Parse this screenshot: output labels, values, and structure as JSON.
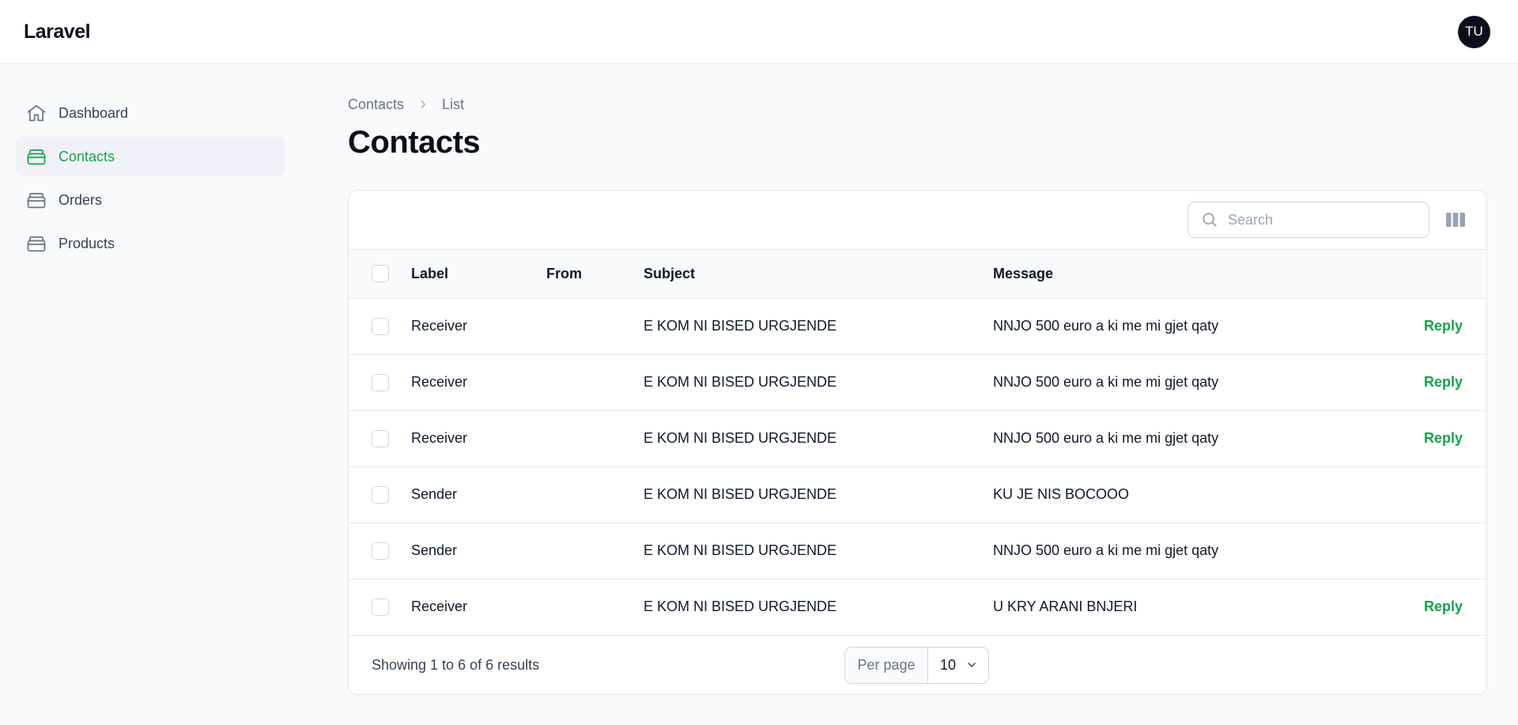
{
  "app": {
    "brand": "Laravel",
    "user_initials": "TU"
  },
  "sidebar": {
    "items": [
      {
        "label": "Dashboard",
        "icon": "home-icon",
        "active": false
      },
      {
        "label": "Contacts",
        "icon": "inbox-icon",
        "active": true
      },
      {
        "label": "Orders",
        "icon": "inbox-icon",
        "active": false
      },
      {
        "label": "Products",
        "icon": "inbox-icon",
        "active": false
      }
    ]
  },
  "breadcrumb": {
    "parent": "Contacts",
    "current": "List"
  },
  "page": {
    "title": "Contacts"
  },
  "search": {
    "placeholder": "Search",
    "value": ""
  },
  "table": {
    "columns": [
      "Label",
      "From",
      "Subject",
      "Message"
    ],
    "rows": [
      {
        "label": "Receiver",
        "from": "",
        "subject": "E KOM NI BISED URGJENDE",
        "message": "NNJO 500 euro a ki me mi gjet qaty",
        "action": "Reply"
      },
      {
        "label": "Receiver",
        "from": "",
        "subject": "E KOM NI BISED URGJENDE",
        "message": "NNJO 500 euro a ki me mi gjet qaty",
        "action": "Reply"
      },
      {
        "label": "Receiver",
        "from": "",
        "subject": "E KOM NI BISED URGJENDE",
        "message": "NNJO 500 euro a ki me mi gjet qaty",
        "action": "Reply"
      },
      {
        "label": "Sender",
        "from": "",
        "subject": "E KOM NI BISED URGJENDE",
        "message": "KU JE NIS BOCOOO",
        "action": ""
      },
      {
        "label": "Sender",
        "from": "",
        "subject": "E KOM NI BISED URGJENDE",
        "message": "NNJO 500 euro a ki me mi gjet qaty",
        "action": ""
      },
      {
        "label": "Receiver",
        "from": "",
        "subject": "E KOM NI BISED URGJENDE",
        "message": "U KRY ARANI BNJERI",
        "action": "Reply"
      }
    ]
  },
  "footer": {
    "results_text": "Showing 1 to 6 of 6 results",
    "per_page_label": "Per page",
    "per_page_value": "10"
  },
  "colors": {
    "accent": "#16a34a",
    "text": "#111827",
    "muted": "#6b7280",
    "border": "#e5e7eb"
  }
}
